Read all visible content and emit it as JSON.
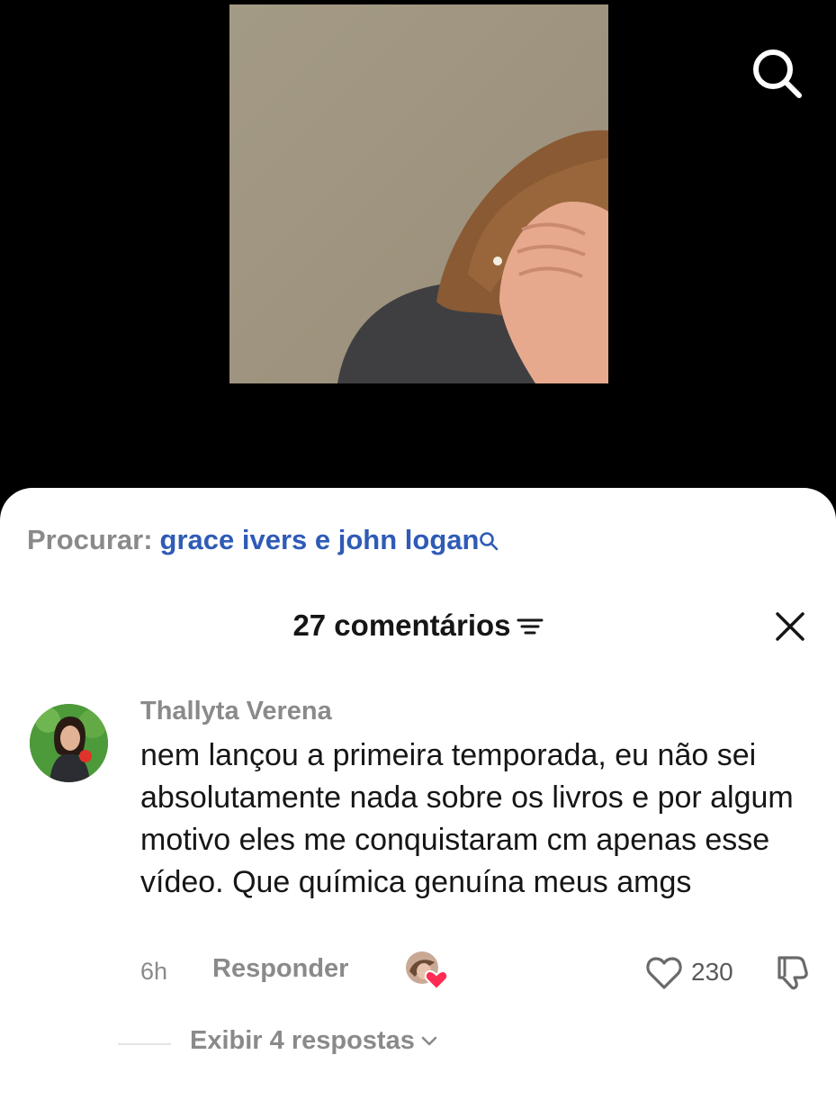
{
  "search_suggestion": {
    "prefix": "Procurar:",
    "query": "grace ivers e john logan"
  },
  "comments_panel": {
    "title": "27 comentários",
    "icons": {
      "sort": "sort-lines-icon",
      "close": "close-icon",
      "search": "search-icon"
    }
  },
  "comment": {
    "username": "Thallyta Verena",
    "text": "nem lançou a primeira temporada, eu não sei absolutamente nada sobre os livros e por algum motivo eles me conquistaram cm apenas esse vídeo. Que química genuína meus amgs",
    "time": "6h",
    "reply_label": "Responder",
    "like_count": "230",
    "view_replies_label": "Exibir 4 respostas"
  },
  "colors": {
    "link_blue": "#2f5bb7",
    "muted_gray": "#8a8a8a",
    "heart_red": "#fe2c55"
  }
}
